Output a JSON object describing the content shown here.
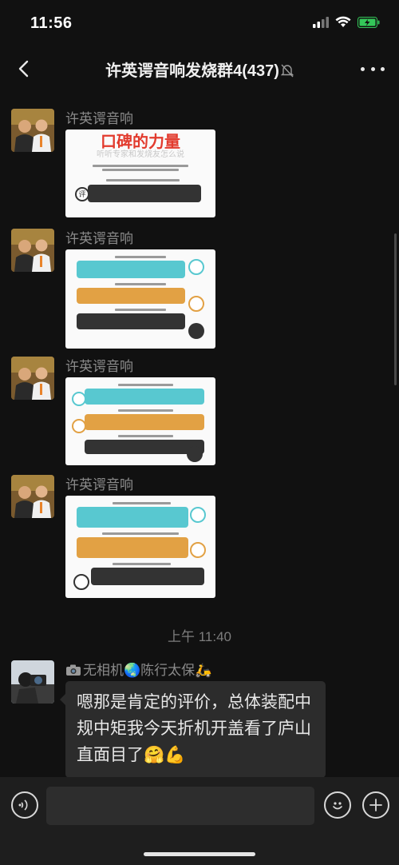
{
  "status_bar": {
    "time": "11:56",
    "battery_color": "#34c759"
  },
  "nav": {
    "title": "许英谔音响发烧群4(437)",
    "back_icon": "chevron-left-icon",
    "mute_icon": "bell-slash-icon",
    "more_icon": "ellipsis-icon"
  },
  "messages": [
    {
      "sender": "许英谔音响",
      "image": {
        "headline": "口碑的力量",
        "subhead": "听听专家和发烧友怎么说"
      }
    },
    {
      "sender": "许英谔音响"
    },
    {
      "sender": "许英谔音响"
    },
    {
      "sender": "许英谔音响"
    }
  ],
  "timestamp": "上午 11:40",
  "text_message": {
    "sender": "无相机🌏陈行太保🛵",
    "sender_prefix_icon": "camera-icon",
    "text": "嗯那是肯定的评价，总体装配中规中矩我今天折机开盖看了庐山直面目了🤗💪"
  },
  "input": {
    "value": "",
    "placeholder": ""
  },
  "colors": {
    "accent_red": "#e23b2e",
    "teal": "#58c8d0",
    "orange": "#e2a144",
    "dark": "#333333"
  }
}
